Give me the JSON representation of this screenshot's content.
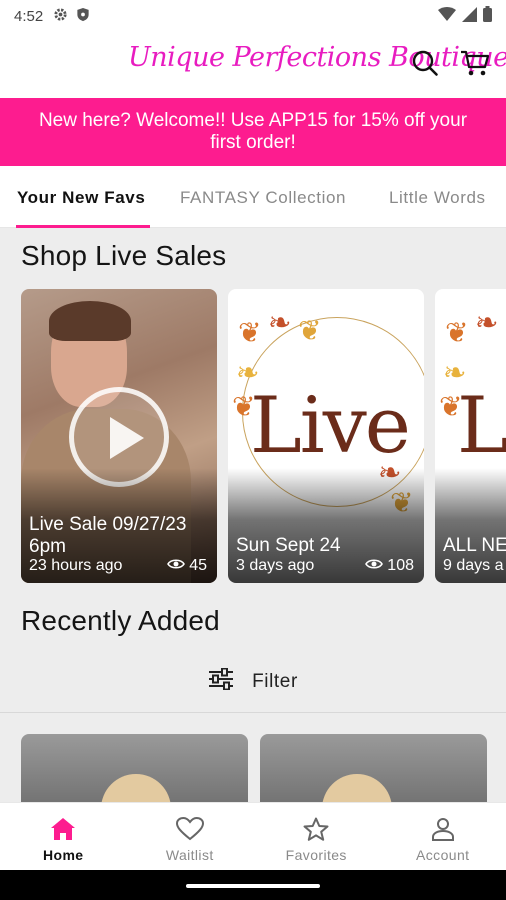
{
  "status_bar": {
    "time": "4:52",
    "icons": [
      "gear-icon",
      "shield-icon",
      "wifi-icon",
      "signal-icon",
      "battery-icon"
    ]
  },
  "header": {
    "brand": "Unique Perfections Boutique",
    "icons": [
      "search-icon",
      "cart-icon"
    ]
  },
  "promo": {
    "text": "New here? Welcome!! Use APP15 for 15% off your first order!",
    "color": "#fd1c8f"
  },
  "tabs": [
    {
      "label": "Your New Favs",
      "active": true
    },
    {
      "label": "FANTASY Collection",
      "active": false
    },
    {
      "label": "Little Words",
      "active": false
    }
  ],
  "live_sales": {
    "title": "Shop Live Sales",
    "cards": [
      {
        "title": "Live Sale 09/27/23 6pm",
        "ago": "23 hours ago",
        "views": "45"
      },
      {
        "title": "Sun Sept 24",
        "ago": "3 days ago",
        "views": "108"
      },
      {
        "title": "ALL NE",
        "ago": "9 days a",
        "views": ""
      }
    ],
    "thumbnail_word": "Live"
  },
  "recently_added": {
    "title": "Recently Added",
    "filter_label": "Filter"
  },
  "bottom_nav": [
    {
      "label": "Home",
      "icon": "home-icon",
      "active": true
    },
    {
      "label": "Waitlist",
      "icon": "heart-icon",
      "active": false
    },
    {
      "label": "Favorites",
      "icon": "star-icon",
      "active": false
    },
    {
      "label": "Account",
      "icon": "person-icon",
      "active": false
    }
  ],
  "colors": {
    "accent": "#fd1c8f",
    "brand": "#e81cc0"
  }
}
